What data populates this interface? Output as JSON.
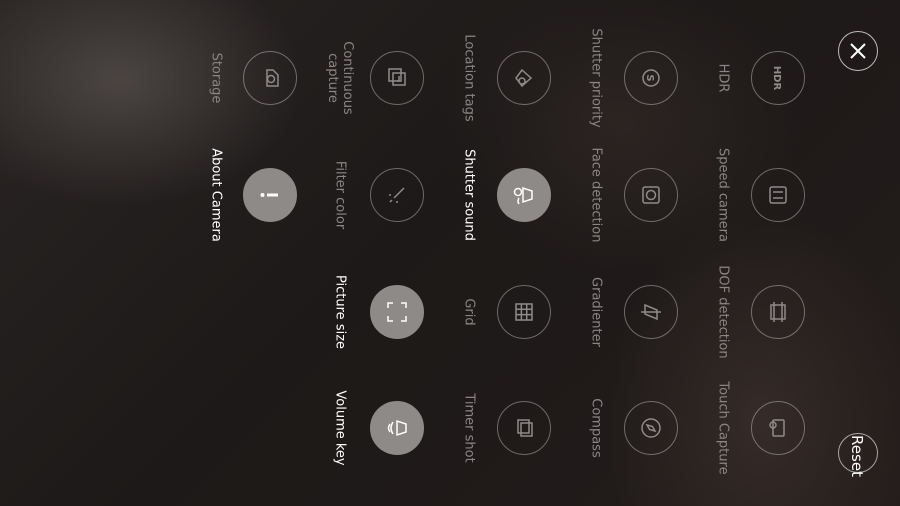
{
  "buttons": {
    "close_icon": "close-icon",
    "reset_label": "Reset"
  },
  "options": [
    {
      "id": "hdr",
      "label": "HDR",
      "icon": "hdr-icon",
      "icon_text": "HDR",
      "active": false
    },
    {
      "id": "speed-camera",
      "label": "Speed camera",
      "icon": "speed-camera-icon",
      "active": false
    },
    {
      "id": "dof-detection",
      "label": "DOF detection",
      "icon": "dof-icon",
      "active": false
    },
    {
      "id": "touch-capture",
      "label": "Touch Capture",
      "icon": "touch-capture-icon",
      "active": false
    },
    {
      "id": "shutter-priority",
      "label": "Shutter priority",
      "icon": "shutter-priority-icon",
      "icon_text": "S",
      "active": false
    },
    {
      "id": "face-detection",
      "label": "Face detection",
      "icon": "face-detection-icon",
      "active": false
    },
    {
      "id": "gradienter",
      "label": "Gradienter",
      "icon": "gradienter-icon",
      "active": false
    },
    {
      "id": "compass",
      "label": "Compass",
      "icon": "compass-icon",
      "active": false
    },
    {
      "id": "location-tags",
      "label": "Location tags",
      "icon": "location-icon",
      "active": false
    },
    {
      "id": "shutter-sound",
      "label": "Shutter sound",
      "icon": "shutter-sound-icon",
      "active": true
    },
    {
      "id": "grid",
      "label": "Grid",
      "icon": "grid-icon",
      "active": false
    },
    {
      "id": "timer-shot",
      "label": "Timer shot",
      "icon": "timer-icon",
      "active": false
    },
    {
      "id": "continuous-capture",
      "label": "Continuous capture",
      "icon": "continuous-capture-icon",
      "active": false
    },
    {
      "id": "filter-color",
      "label": "Filter color",
      "icon": "filter-color-icon",
      "active": false
    },
    {
      "id": "picture-size",
      "label": "Picture size",
      "icon": "picture-size-icon",
      "active": true
    },
    {
      "id": "volume-key",
      "label": "Volume key",
      "icon": "volume-key-icon",
      "active": true
    },
    {
      "id": "storage",
      "label": "Storage",
      "icon": "storage-icon",
      "active": false
    },
    {
      "id": "about-camera",
      "label": "About Camera",
      "icon": "about-icon",
      "active": true
    }
  ]
}
